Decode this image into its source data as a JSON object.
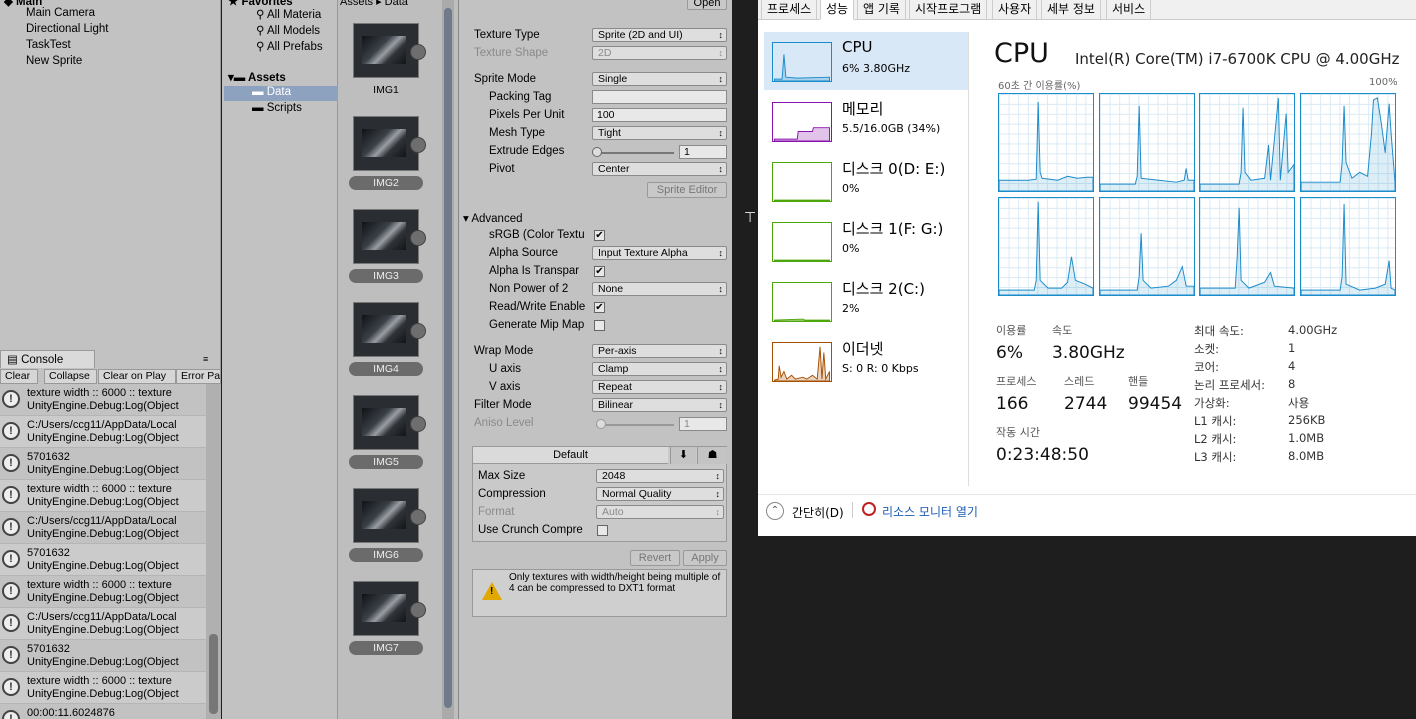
{
  "hierarchy": {
    "scene_label": "Main",
    "items": [
      "Main Camera",
      "Directional Light",
      "TaskTest",
      "New Sprite"
    ]
  },
  "console": {
    "tab": "Console",
    "buttons": [
      "Clear",
      "Collapse",
      "Clear on Play",
      "Error Pa"
    ],
    "logs": [
      {
        "l1": "texture width :: 6000 :: texture",
        "l2": "UnityEngine.Debug:Log(Object"
      },
      {
        "l1": "C:/Users/ccg11/AppData/Local",
        "l2": "UnityEngine.Debug:Log(Object"
      },
      {
        "l1": "5701632",
        "l2": "UnityEngine.Debug:Log(Object"
      },
      {
        "l1": "texture width :: 6000 :: texture",
        "l2": "UnityEngine.Debug:Log(Object"
      },
      {
        "l1": "C:/Users/ccg11/AppData/Local",
        "l2": "UnityEngine.Debug:Log(Object"
      },
      {
        "l1": "5701632",
        "l2": "UnityEngine.Debug:Log(Object"
      },
      {
        "l1": "texture width :: 6000 :: texture",
        "l2": "UnityEngine.Debug:Log(Object"
      },
      {
        "l1": "C:/Users/ccg11/AppData/Local",
        "l2": "UnityEngine.Debug:Log(Object"
      },
      {
        "l1": "5701632",
        "l2": "UnityEngine.Debug:Log(Object"
      },
      {
        "l1": "texture width :: 6000 :: texture",
        "l2": "UnityEngine.Debug:Log(Object"
      },
      {
        "l1": "00:00:11.6024876",
        "l2": ""
      }
    ]
  },
  "project": {
    "favorites": "Favorites",
    "fav_items": [
      "All Materia",
      "All Models",
      "All Prefabs"
    ],
    "assets": "Assets",
    "folders": [
      "Data",
      "Scripts"
    ],
    "breadcrumb": "Assets ▸ Data",
    "grid_items": [
      "IMG1",
      "IMG2",
      "IMG3",
      "IMG4",
      "IMG5",
      "IMG6",
      "IMG7"
    ]
  },
  "inspector": {
    "open_button": "Open",
    "texture_type_label": "Texture Type",
    "texture_type": "Sprite (2D and UI)",
    "texture_shape_label": "Texture Shape",
    "texture_shape": "2D",
    "sprite_mode_label": "Sprite Mode",
    "sprite_mode": "Single",
    "packing_tag_label": "Packing Tag",
    "packing_tag": "",
    "ppu_label": "Pixels Per Unit",
    "ppu": "100",
    "mesh_type_label": "Mesh Type",
    "mesh_type": "Tight",
    "extrude_label": "Extrude Edges",
    "extrude": "1",
    "pivot_label": "Pivot",
    "pivot": "Center",
    "sprite_editor": "Sprite Editor",
    "advanced": "Advanced",
    "srgb_label": "sRGB (Color Textu",
    "alpha_source_label": "Alpha Source",
    "alpha_source": "Input Texture Alpha",
    "alpha_transp_label": "Alpha Is Transpar",
    "npot_label": "Non Power of 2",
    "npot": "None",
    "rw_label": "Read/Write Enable",
    "mip_label": "Generate Mip Map",
    "wrap_label": "Wrap Mode",
    "wrap": "Per-axis",
    "u_label": "U axis",
    "u": "Clamp",
    "v_label": "V axis",
    "v": "Repeat",
    "filter_label": "Filter Mode",
    "filter": "Bilinear",
    "aniso_label": "Aniso Level",
    "aniso": "1",
    "platform_tab": "Default",
    "max_size_label": "Max Size",
    "max_size": "2048",
    "compression_label": "Compression",
    "compression": "Normal Quality",
    "format_label": "Format",
    "format": "Auto",
    "crunch_label": "Use Crunch Compre",
    "revert": "Revert",
    "apply": "Apply",
    "warning": "Only textures with width/height being multiple of 4 can be compressed to DXT1 format"
  },
  "taskmgr": {
    "tabs": [
      "프로세스",
      "성능",
      "앱 기록",
      "시작프로그램",
      "사용자",
      "세부 정보",
      "서비스"
    ],
    "sidebar": [
      {
        "name": "CPU",
        "sub": "6% 3.80GHz",
        "color": "#1a8bcb"
      },
      {
        "name": "메모리",
        "sub": "5.5/16.0GB (34%)",
        "color": "#8b12ae"
      },
      {
        "name": "디스크 0(D: E:)",
        "sub": "0%",
        "color": "#4da60c"
      },
      {
        "name": "디스크 1(F: G:)",
        "sub": "0%",
        "color": "#4da60c"
      },
      {
        "name": "디스크 2(C:)",
        "sub": "2%",
        "color": "#4da60c"
      },
      {
        "name": "이더넷",
        "sub": "S: 0 R: 0 Kbps",
        "color": "#a74f01"
      }
    ],
    "title": "CPU",
    "cpu_model": "Intel(R) Core(TM) i7-6700K CPU @ 4.00GHz",
    "graph_caption": "60초 간 이용률(%)",
    "graph_max": "100%",
    "stats": {
      "util_label": "이용률",
      "util": "6%",
      "speed_label": "속도",
      "speed": "3.80GHz",
      "proc_label": "프로세스",
      "proc": "166",
      "thread_label": "스레드",
      "thread": "2744",
      "handle_label": "핸들",
      "handle": "99454",
      "uptime_label": "작동 시간",
      "uptime": "0:23:48:50"
    },
    "specs": [
      {
        "k": "최대 속도:",
        "v": "4.00GHz"
      },
      {
        "k": "소켓:",
        "v": "1"
      },
      {
        "k": "코어:",
        "v": "4"
      },
      {
        "k": "논리 프로세서:",
        "v": "8"
      },
      {
        "k": "가상화:",
        "v": "사용"
      },
      {
        "k": "L1 캐시:",
        "v": "256KB"
      },
      {
        "k": "L2 캐시:",
        "v": "1.0MB"
      },
      {
        "k": "L3 캐시:",
        "v": "8.0MB"
      }
    ],
    "fewer_details": "간단히(D)",
    "resource_monitor": "리소스 모니터 열기"
  }
}
